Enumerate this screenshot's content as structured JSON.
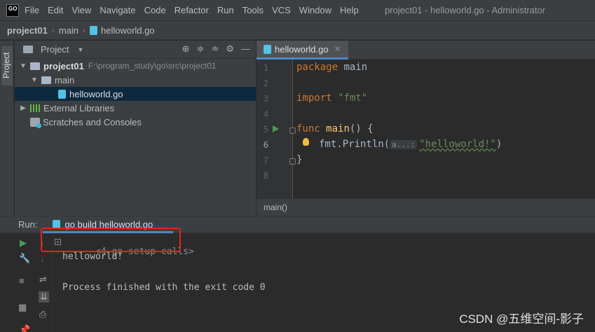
{
  "app": {
    "logo_text": "GO",
    "menu": [
      "File",
      "Edit",
      "View",
      "Navigate",
      "Code",
      "Refactor",
      "Run",
      "Tools",
      "VCS",
      "Window",
      "Help"
    ],
    "window_title": "project01 - helloworld.go - Administrator"
  },
  "breadcrumb": {
    "project": "project01",
    "folder": "main",
    "file": "helloworld.go"
  },
  "left_stripe": {
    "project_label": "Project"
  },
  "project_panel": {
    "title": "Project",
    "tree": {
      "root_name": "project01",
      "root_path": "F:\\program_study\\go\\src\\project01",
      "folder": "main",
      "file": "helloworld.go",
      "external_libraries": "External Libraries",
      "scratches": "Scratches and Consoles"
    }
  },
  "editor": {
    "tab": "helloworld.go",
    "line_numbers": [
      "1",
      "2",
      "3",
      "4",
      "5",
      "6",
      "7",
      "8"
    ],
    "code": {
      "l1_kw": "package",
      "l1_rest": " main",
      "l3_kw": "import",
      "l3_str": "\"fmt\"",
      "l5_kw": "func",
      "l5_fn": "main",
      "l5_rest": "() {",
      "l6_a": "fmt.Println(",
      "l6_hint": "a...:",
      "l6_str": "\"helloworld!\"",
      "l6_b": ")",
      "l7": "}"
    },
    "breadcrumb": "main()"
  },
  "run_panel": {
    "label": "Run:",
    "tab": "go build helloworld.go",
    "console": {
      "setup_calls": "<4 go setup calls>",
      "output": "helloworld!",
      "finished": "Process finished with the exit code 0"
    }
  },
  "colors": {
    "highlight": "#e8221f",
    "accent": "#4a88c7"
  },
  "watermark": "CSDN @五维空间-影子"
}
